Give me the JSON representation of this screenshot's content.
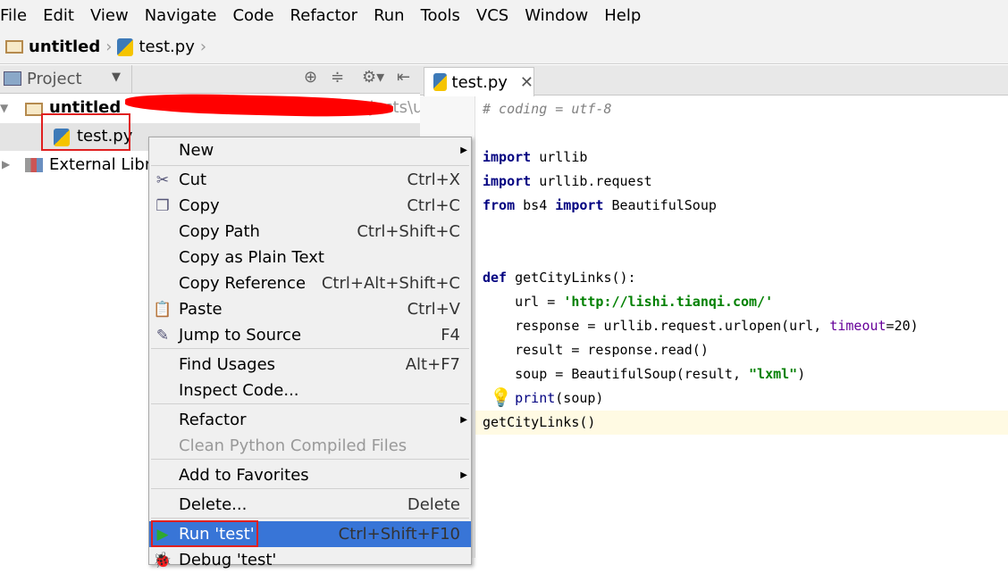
{
  "menubar": [
    "File",
    "Edit",
    "View",
    "Navigate",
    "Code",
    "Refactor",
    "Run",
    "Tools",
    "VCS",
    "Window",
    "Help"
  ],
  "breadcrumb": {
    "project": "untitled",
    "file": "test.py"
  },
  "project_panel": {
    "title": "Project",
    "root": "untitled",
    "root_path": "Projects\\u",
    "file": "test.py",
    "external": "External Libra"
  },
  "editor": {
    "tab": "test.py",
    "lines": [
      {
        "t": "# coding = utf-8"
      },
      {
        "t": "import urllib"
      },
      {
        "t": "import urllib.request"
      },
      {
        "t": "from bs4 import BeautifulSoup"
      },
      {
        "t": "def getCityLinks():"
      },
      {
        "t": "    url = 'http://lishi.tianqi.com/'"
      },
      {
        "t": "    response = urllib.request.urlopen(url, timeout=20)"
      },
      {
        "t": "    result = response.read()"
      },
      {
        "t": "    soup = BeautifulSoup(result, \"lxml\")"
      },
      {
        "t": "    print(soup)"
      },
      {
        "t": "getCityLinks()"
      }
    ]
  },
  "context_menu": [
    {
      "label": "New",
      "shortcut": "",
      "submenu": true
    },
    {
      "label": "Cut",
      "shortcut": "Ctrl+X",
      "icon": "scissors-icon"
    },
    {
      "label": "Copy",
      "shortcut": "Ctrl+C",
      "icon": "copy-icon"
    },
    {
      "label": "Copy Path",
      "shortcut": "Ctrl+Shift+C"
    },
    {
      "label": "Copy as Plain Text",
      "shortcut": ""
    },
    {
      "label": "Copy Reference",
      "shortcut": "Ctrl+Alt+Shift+C"
    },
    {
      "label": "Paste",
      "shortcut": "Ctrl+V",
      "icon": "paste-icon"
    },
    {
      "label": "Jump to Source",
      "shortcut": "F4",
      "icon": "jump-to-source-icon"
    },
    {
      "label": "Find Usages",
      "shortcut": "Alt+F7"
    },
    {
      "label": "Inspect Code...",
      "shortcut": ""
    },
    {
      "label": "Refactor",
      "shortcut": "",
      "submenu": true
    },
    {
      "label": "Clean Python Compiled Files",
      "shortcut": "",
      "disabled": true
    },
    {
      "label": "Add to Favorites",
      "shortcut": "",
      "submenu": true
    },
    {
      "label": "Delete...",
      "shortcut": "Delete"
    },
    {
      "label": "Run 'test'",
      "shortcut": "Ctrl+Shift+F10",
      "icon": "run-icon",
      "selected": true
    },
    {
      "label": "Debug 'test'",
      "shortcut": "",
      "icon": "debug-icon"
    }
  ]
}
